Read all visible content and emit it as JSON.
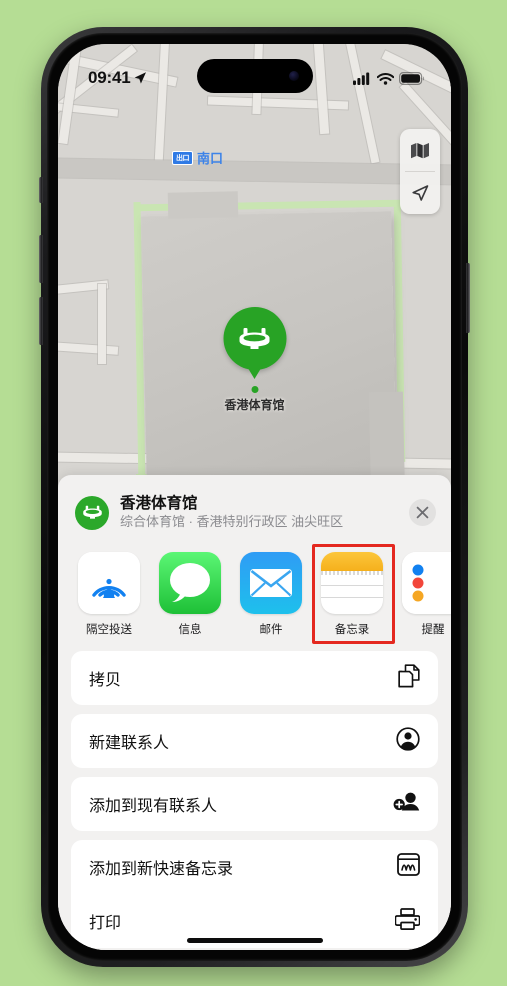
{
  "background_color": "#b5dd94",
  "status_bar": {
    "time": "09:41",
    "location_arrow": "location-arrow-icon",
    "cellular": "cellular-signal-icon",
    "wifi": "wifi-icon",
    "battery": "battery-full-icon"
  },
  "map": {
    "transit_exit": {
      "badge": "出口",
      "label": "南口"
    },
    "pin": {
      "label": "香港体育馆",
      "color": "#28a325",
      "icon": "stadium-icon"
    },
    "controls": [
      {
        "name": "map-mode-button",
        "icon": "folded-map-icon"
      },
      {
        "name": "user-location-button",
        "icon": "location-arrow-icon"
      }
    ]
  },
  "share_sheet": {
    "place": {
      "title": "香港体育馆",
      "subtitle": "综合体育馆 · 香港特别行政区 油尖旺区",
      "icon": "stadium-icon",
      "icon_color": "#2ba82a"
    },
    "close_label": "×",
    "apps": [
      {
        "label": "隔空投送",
        "icon": "airdrop-icon"
      },
      {
        "label": "信息",
        "icon": "messages-icon"
      },
      {
        "label": "邮件",
        "icon": "mail-icon"
      },
      {
        "label": "备忘录",
        "icon": "notes-icon",
        "highlighted": true,
        "highlight_color": "#e4281f"
      },
      {
        "label": "提醒",
        "icon": "reminders-icon"
      }
    ],
    "actions": [
      {
        "label": "拷贝",
        "icon": "copy-icon"
      },
      {
        "label": "新建联系人",
        "icon": "new-contact-icon"
      },
      {
        "label": "添加到现有联系人",
        "icon": "add-to-contact-icon"
      },
      {
        "label": "添加到新快速备忘录",
        "icon": "quick-note-icon"
      },
      {
        "label": "打印",
        "icon": "printer-icon"
      }
    ]
  }
}
